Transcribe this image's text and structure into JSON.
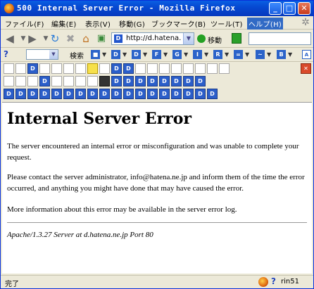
{
  "window": {
    "title": "500 Internal Server Error - Mozilla Firefox",
    "minimize_glyph": "_",
    "maximize_glyph": "□",
    "close_glyph": "✕"
  },
  "menubar": {
    "items": [
      "ファイル(F)",
      "編集(E)",
      "表示(V)",
      "移動(G)",
      "ブックマーク(B)",
      "ツール(T)",
      "ヘルプ(H)"
    ],
    "active_item": "ヘルプ(H)"
  },
  "navigation": {
    "url": "http://d.hatena.ne.jp/",
    "site_icon_letter": "D",
    "go_label": "移動",
    "back_glyph": "◀",
    "forward_glyph": "▶",
    "reload_glyph": "↻",
    "stop_glyph": "✖",
    "home_glyph": "⌂",
    "dropdown_glyph": "▼"
  },
  "extension_toolbar": {
    "help_glyph": "?",
    "search_label": "検索",
    "tool_letters": [
      "■",
      "D",
      "D",
      "F",
      "G",
      "I",
      "R",
      "=",
      "~",
      "B"
    ],
    "arrow_glyph": "▼"
  },
  "icon_rows": {
    "row1": [
      "p",
      "p",
      "d",
      "p",
      "p",
      "p",
      "p",
      "y",
      "p",
      "d",
      "d",
      "p",
      "p",
      "p",
      "p",
      "p",
      "p",
      "p",
      "p"
    ],
    "row2": [
      "p",
      "p",
      "p",
      "d",
      "p",
      "p",
      "p",
      "p",
      "k",
      "d",
      "d",
      "d",
      "d",
      "d",
      "d",
      "d",
      "d"
    ],
    "row3": [
      "d",
      "d",
      "d",
      "d",
      "d",
      "d",
      "d",
      "d",
      "d",
      "d",
      "d",
      "d",
      "d",
      "d",
      "d",
      "d",
      "d",
      "d"
    ]
  },
  "content": {
    "heading": "Internal Server Error",
    "paragraph1": "The server encountered an internal error or misconfiguration and was unable to complete your request.",
    "paragraph2": "Please contact the server administrator, info@hatena.ne.jp and inform them of the time the error occurred, and anything you might have done that may have caused the error.",
    "paragraph3": "More information about this error may be available in the server error log.",
    "address": "Apache/1.3.27 Server at d.hatena.ne.jp Port 80"
  },
  "statusbar": {
    "status_text": "完了",
    "help_glyph": "?",
    "user": "rin51"
  },
  "colors": {
    "titlebar": "#0649D2",
    "chrome": "#ECE9D8",
    "menu_highlight": "#316AC5",
    "toolbar_blue": "#2b5ec9"
  }
}
